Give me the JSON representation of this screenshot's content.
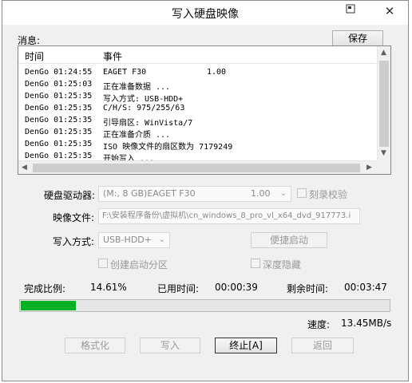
{
  "window": {
    "title": "写入硬盘映像",
    "menu_icon": "menu-icon",
    "close_glyph": "✕"
  },
  "messages": {
    "label": "消息:",
    "save_label": "保存",
    "columns": [
      "时间",
      "事件"
    ],
    "rows": [
      {
        "time": "DenGo 01:24:55",
        "event": "EAGET   F30",
        "extra": "1.00"
      },
      {
        "time": "DenGo 01:25:03",
        "event": "正在准备数据 ..."
      },
      {
        "time": "DenGo 01:25:35",
        "event": "写入方式: USB-HDD+"
      },
      {
        "time": "DenGo 01:25:35",
        "event": "C/H/S: 975/255/63"
      },
      {
        "time": "DenGo 01:25:35",
        "event": "引导扇区: WinVista/7"
      },
      {
        "time": "DenGo 01:25:35",
        "event": "正在准备介质 ..."
      },
      {
        "time": "DenGo 01:25:35",
        "event": "ISO 映像文件的扇区数为 7179249"
      },
      {
        "time": "DenGo 01:25:35",
        "event": "开始写入 ..."
      }
    ]
  },
  "drive": {
    "label": "硬盘驱动器:",
    "value": "(M:, 8 GB)EAGET   F30",
    "version": "1.00",
    "verify_label": "刻录校验"
  },
  "image_file": {
    "label": "映像文件:",
    "value": "F:\\安装程序备份\\虚拟机\\cn_windows_8_pro_vl_x64_dvd_917773.i"
  },
  "write_mode": {
    "label": "写入方式:",
    "value": "USB-HDD+",
    "quick_boot_label": "便捷启动",
    "create_partition_label": "创建启动分区",
    "deep_hide_label": "深度隐藏"
  },
  "status": {
    "ratio_label": "完成比例:",
    "ratio_value": "14.61%",
    "progress_fraction": 0.1461,
    "elapsed_label": "已用时间:",
    "elapsed_value": "00:00:39",
    "remaining_label": "剩余时间:",
    "remaining_value": "00:03:47",
    "speed_label": "速度:",
    "speed_value": "13.45MB/s"
  },
  "actions": {
    "format_label": "格式化",
    "write_label": "写入",
    "stop_label": "终止[A]",
    "back_label": "返回"
  },
  "colors": {
    "progress": "#06b025",
    "disabled_text": "#9a9a9a"
  }
}
